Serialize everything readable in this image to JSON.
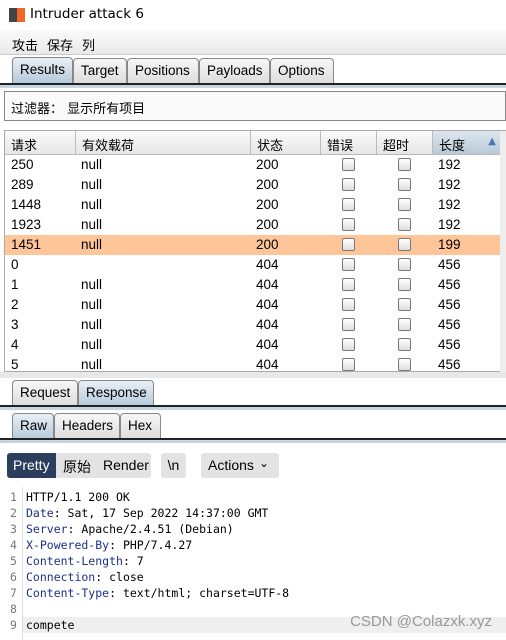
{
  "window": {
    "title": "Intruder attack 6"
  },
  "menu": [
    "攻击",
    "保存",
    "列"
  ],
  "tabs": [
    "Results",
    "Target",
    "Positions",
    "Payloads",
    "Options"
  ],
  "filter": "过滤器： 显示所有项目",
  "table": {
    "columns": [
      "请求",
      "有效载荷",
      "状态",
      "错误",
      "超时",
      "长度"
    ],
    "sort_column": "长度",
    "sort_direction": "ascending",
    "rows": [
      {
        "req": "250",
        "payload": "null",
        "status": "200",
        "len": "192"
      },
      {
        "req": "289",
        "payload": "null",
        "status": "200",
        "len": "192"
      },
      {
        "req": "1448",
        "payload": "null",
        "status": "200",
        "len": "192"
      },
      {
        "req": "1923",
        "payload": "null",
        "status": "200",
        "len": "192"
      },
      {
        "req": "1451",
        "payload": "null",
        "status": "200",
        "len": "199",
        "highlight": true
      },
      {
        "req": "0",
        "payload": "",
        "status": "404",
        "len": "456"
      },
      {
        "req": "1",
        "payload": "null",
        "status": "404",
        "len": "456"
      },
      {
        "req": "2",
        "payload": "null",
        "status": "404",
        "len": "456"
      },
      {
        "req": "3",
        "payload": "null",
        "status": "404",
        "len": "456"
      },
      {
        "req": "4",
        "payload": "null",
        "status": "404",
        "len": "456"
      },
      {
        "req": "5",
        "payload": "null",
        "status": "404",
        "len": "456"
      }
    ]
  },
  "reqresp_tabs": [
    "Request",
    "Response"
  ],
  "view_tabs": [
    "Raw",
    "Headers",
    "Hex"
  ],
  "toolbar": {
    "pretty": "Pretty",
    "raw": "原始",
    "render": "Render",
    "newline": "\\n",
    "actions": "Actions"
  },
  "response_lines": [
    {
      "n": "1",
      "key": "",
      "val": "HTTP/1.1 200 OK"
    },
    {
      "n": "2",
      "key": "Date",
      "val": ": Sat, 17 Sep 2022 14:37:00 GMT"
    },
    {
      "n": "3",
      "key": "Server",
      "val": ": Apache/2.4.51 (Debian)"
    },
    {
      "n": "4",
      "key": "X-Powered-By",
      "val": ": PHP/7.4.27"
    },
    {
      "n": "5",
      "key": "Content-Length",
      "val": ": 7"
    },
    {
      "n": "6",
      "key": "Connection",
      "val": ": close"
    },
    {
      "n": "7",
      "key": "Content-Type",
      "val": ": text/html; charset=UTF-8"
    },
    {
      "n": "8",
      "key": "",
      "val": ""
    },
    {
      "n": "9",
      "key": "",
      "val": "compete"
    }
  ],
  "watermark": "CSDN @Colazxk.xyz",
  "colors": {
    "highlight_row": "#ffc599",
    "header_key": "#1c2f8c",
    "pretty_active": "#2c3e5e"
  }
}
